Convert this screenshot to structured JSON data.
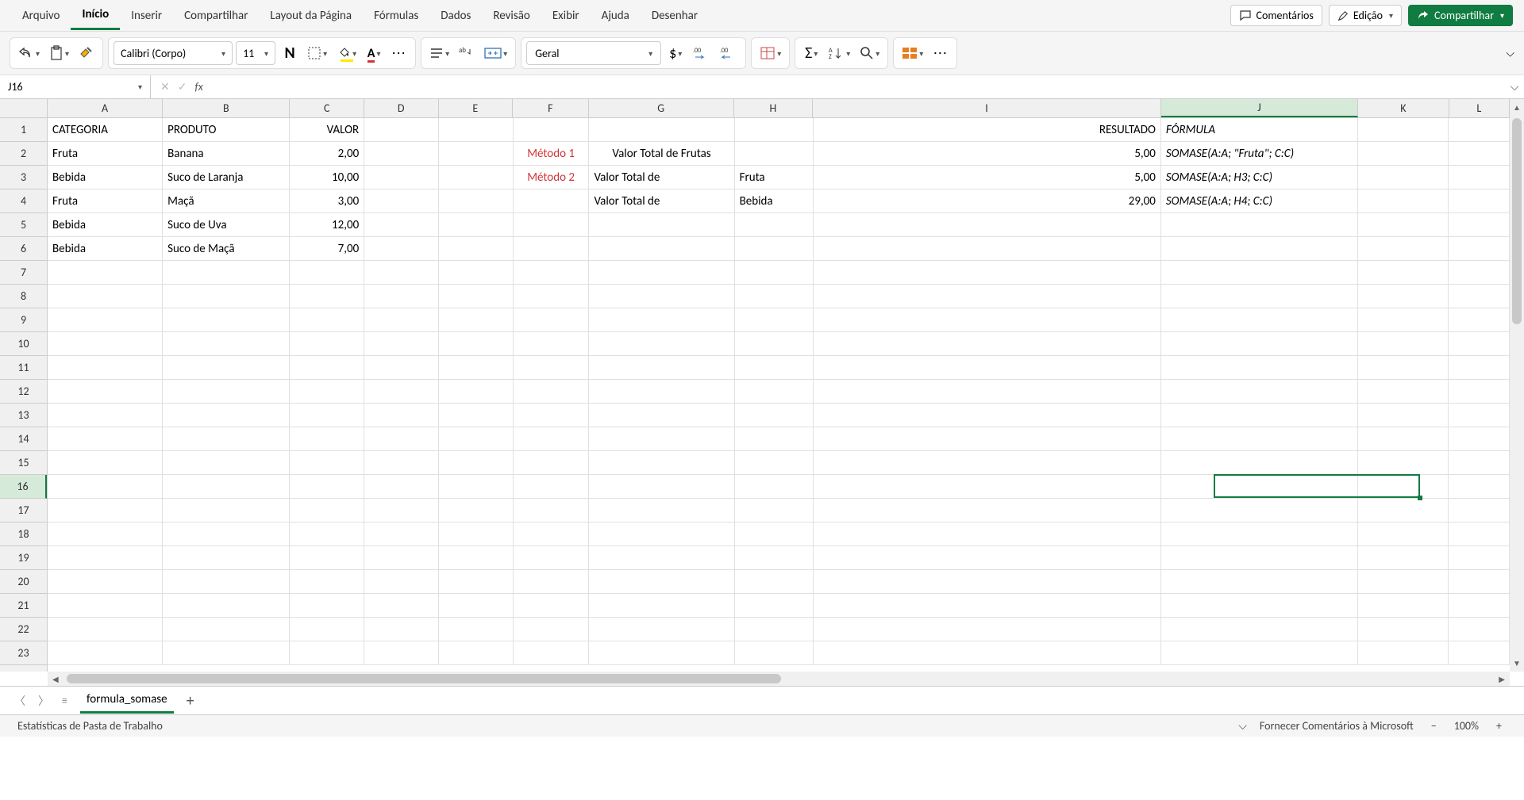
{
  "tabs": {
    "arquivo": "Arquivo",
    "inicio": "Início",
    "inserir": "Inserir",
    "compartilhar": "Compartilhar",
    "layout": "Layout da Página",
    "formulas": "Fórmulas",
    "dados": "Dados",
    "revisao": "Revisão",
    "exibir": "Exibir",
    "ajuda": "Ajuda",
    "desenhar": "Desenhar"
  },
  "top_buttons": {
    "comentarios": "Comentários",
    "edicao": "Edição",
    "compartilhar": "Compartilhar"
  },
  "ribbon": {
    "font_name": "Calibri (Corpo)",
    "font_size": "11",
    "bold": "N",
    "number_format": "Geral",
    "currency": "$",
    "ellipsis": "⋯"
  },
  "namebox": "J16",
  "fx_label": "fx",
  "formula_value": "",
  "columns": [
    "A",
    "B",
    "C",
    "D",
    "E",
    "F",
    "G",
    "H",
    "I",
    "J",
    "K",
    "L"
  ],
  "rows": [
    "1",
    "2",
    "3",
    "4",
    "5",
    "6",
    "7",
    "8",
    "9",
    "10",
    "11",
    "12",
    "13",
    "14",
    "15",
    "16",
    "17",
    "18",
    "19",
    "20",
    "21",
    "22",
    "23"
  ],
  "selected": {
    "col": "J",
    "row": "16"
  },
  "cells": {
    "r1": {
      "A": "CATEGORIA",
      "B": "PRODUTO",
      "C": "VALOR",
      "I": "RESULTADO",
      "J": "FÓRMULA"
    },
    "r2": {
      "A": "Fruta",
      "B": "Banana",
      "C": "2,00",
      "F": "Método 1",
      "G": "Valor Total de Frutas",
      "I": "5,00",
      "J": "SOMASE(A:A; \"Fruta\"; C:C)"
    },
    "r3": {
      "A": "Bebida",
      "B": "Suco de Laranja",
      "C": "10,00",
      "F": "Método 2",
      "G": "Valor Total de",
      "H": "Fruta",
      "I": "5,00",
      "J": "SOMASE(A:A; H3; C:C)"
    },
    "r4": {
      "A": "Fruta",
      "B": "Maçã",
      "C": "3,00",
      "G": "Valor Total de",
      "H": "Bebida",
      "I": "29,00",
      "J": "SOMASE(A:A; H4; C:C)"
    },
    "r5": {
      "A": "Bebida",
      "B": "Suco de Uva",
      "C": "12,00"
    },
    "r6": {
      "A": "Bebida",
      "B": "Suco de Maçã",
      "C": "7,00"
    }
  },
  "sheet": {
    "name": "formula_somase"
  },
  "status": {
    "left": "Estatísticas de Pasta de Trabalho",
    "feedback": "Fornecer Comentários à Microsoft",
    "zoom": "100%"
  }
}
